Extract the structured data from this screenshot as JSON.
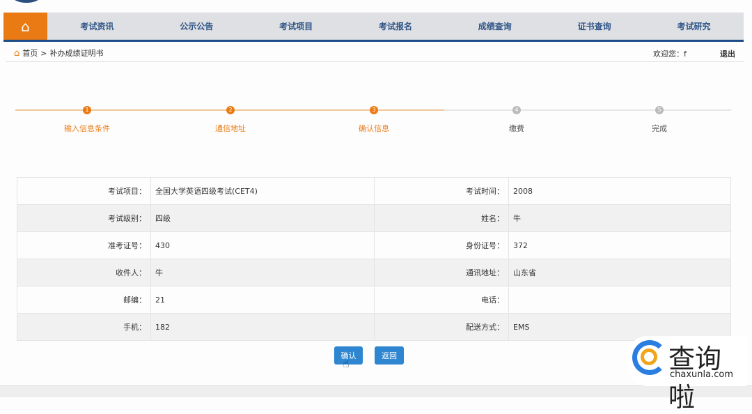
{
  "nav": {
    "home_icon": "home-icon",
    "items": [
      "考试资讯",
      "公示公告",
      "考试项目",
      "考试报名",
      "成绩查询",
      "证书查询",
      "考试研究"
    ]
  },
  "breadcrumb": {
    "home": "首页",
    "separator": ">",
    "current": "补办成绩证明书"
  },
  "user": {
    "welcome": "欢迎您：f",
    "logout": "退出"
  },
  "steps": {
    "active_color": "#ea7b14",
    "inactive_color": "#bbbbbb",
    "current": 3,
    "items": [
      {
        "num": "1",
        "label": "输入信息条件"
      },
      {
        "num": "2",
        "label": "通信地址"
      },
      {
        "num": "3",
        "label": "确认信息"
      },
      {
        "num": "4",
        "label": "缴费"
      },
      {
        "num": "5",
        "label": "完成"
      }
    ]
  },
  "table": {
    "rows": [
      {
        "l1": "考试项目：",
        "v1": "全国大学英语四级考试(CET4)",
        "l2": "考试时间：",
        "v2": "2008"
      },
      {
        "l1": "考试级别：",
        "v1": "四级",
        "l2": "姓名：",
        "v2": "牛"
      },
      {
        "l1": "准考证号：",
        "v1": "430",
        "l2": "身份证号：",
        "v2": "372"
      },
      {
        "l1": "收件人：",
        "v1": "牛",
        "l2": "通讯地址：",
        "v2": "山东省"
      },
      {
        "l1": "邮编：",
        "v1": "21",
        "l2": "电话：",
        "v2": ""
      },
      {
        "l1": "手机：",
        "v1": "182",
        "l2": "配送方式：",
        "v2": "EMS"
      }
    ]
  },
  "buttons": {
    "confirm": "确认",
    "back": "返回"
  },
  "watermark": {
    "brand": "查询啦",
    "domain": "chaxunla.com"
  }
}
